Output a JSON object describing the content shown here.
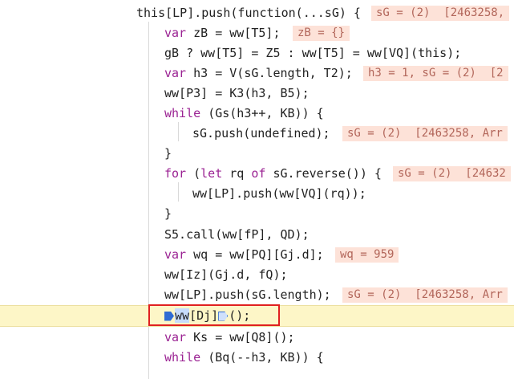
{
  "editor": {
    "lines": [
      {
        "id": "l1",
        "text": "this[LP].push(function(...sG) {",
        "badge": "sG = (2)  [2463258,"
      },
      {
        "id": "l2",
        "text": "var zB = ww[T5];",
        "badge": "zB = {}"
      },
      {
        "id": "l3",
        "text": "gB ? ww[T5] = Z5 : ww[T5] = ww[VQ](this);",
        "badge": ""
      },
      {
        "id": "l4",
        "text": "var h3 = V(sG.length, T2);",
        "badge": "h3 = 1, sG = (2)  [2"
      },
      {
        "id": "l5",
        "text": "ww[P3] = K3(h3, B5);",
        "badge": ""
      },
      {
        "id": "l6",
        "text": "while (Gs(h3++, KB)) {",
        "badge": ""
      },
      {
        "id": "l7",
        "text": "sG.push(undefined);",
        "badge": "sG = (2)  [2463258, Arr"
      },
      {
        "id": "l8",
        "text": "}",
        "badge": ""
      },
      {
        "id": "l9",
        "text": "for (let rq of sG.reverse()) {",
        "badge": "sG = (2)  [24632"
      },
      {
        "id": "l10",
        "text": "ww[LP].push(ww[VQ](rq));",
        "badge": ""
      },
      {
        "id": "l11",
        "text": "}",
        "badge": ""
      },
      {
        "id": "l12",
        "text": "S5.call(ww[fP], QD);",
        "badge": ""
      },
      {
        "id": "l13",
        "text": "var wq = ww[PQ][Gj.d];",
        "badge": "wq = 959"
      },
      {
        "id": "l14",
        "text": "ww[Iz](Gj.d, fQ);",
        "badge": ""
      },
      {
        "id": "l15",
        "text": "ww[LP].push(sG.length);",
        "badge": "sG = (2)  [2463258, Arr"
      },
      {
        "id": "l16",
        "text": "ww[Dj]();",
        "badge": ""
      },
      {
        "id": "l17",
        "text": "var Ks = ww[Q8]();",
        "badge": ""
      },
      {
        "id": "l18",
        "text": "while (Bq(--h3, KB)) {",
        "badge": ""
      }
    ],
    "current_line": {
      "part1": "ww",
      "part2": "[Dj]",
      "part3": "();"
    }
  },
  "colors": {
    "keyword": "#9b2393",
    "badge_bg": "#fde2d8",
    "badge_fg": "#b2665a",
    "exec_highlight": "#fdf6c7",
    "redbox": "#e02020"
  }
}
